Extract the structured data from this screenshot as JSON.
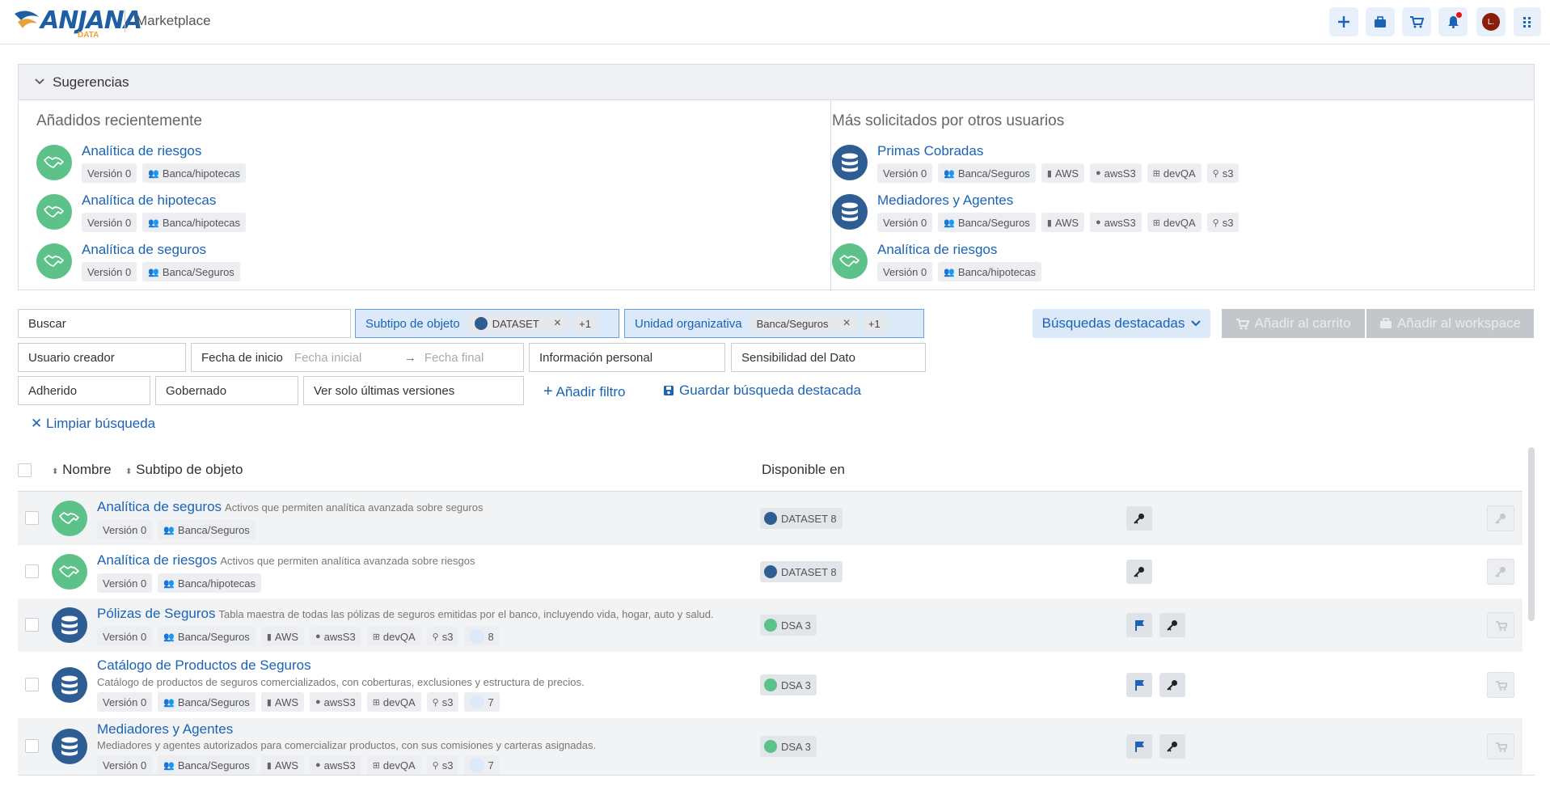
{
  "header": {
    "logo_text": "ANJANA",
    "logo_sub": "DATA",
    "title": "Marketplace",
    "avatar_initial": "L."
  },
  "suggestions": {
    "title": "Sugerencias",
    "recent": {
      "title": "Añadidos recientemente",
      "items": [
        {
          "name": "Analítica de riesgos",
          "icon": "handshake-icon",
          "tags": [
            "Versión 0",
            "Banca/hipotecas"
          ]
        },
        {
          "name": "Analítica de hipotecas",
          "icon": "handshake-icon",
          "tags": [
            "Versión 0",
            "Banca/hipotecas"
          ]
        },
        {
          "name": "Analítica de seguros",
          "icon": "handshake-icon",
          "tags": [
            "Versión 0",
            "Banca/Seguros"
          ]
        }
      ]
    },
    "popular": {
      "title": "Más solicitados por otros usuarios",
      "items": [
        {
          "name": "Primas Cobradas",
          "icon": "database-icon",
          "tags": [
            "Versión 0",
            "Banca/Seguros",
            "AWS",
            "awsS3",
            "devQA",
            "s3"
          ]
        },
        {
          "name": "Mediadores y Agentes",
          "icon": "database-icon",
          "tags": [
            "Versión 0",
            "Banca/Seguros",
            "AWS",
            "awsS3",
            "devQA",
            "s3"
          ]
        },
        {
          "name": "Analítica de riesgos",
          "icon": "handshake-icon",
          "tags": [
            "Versión 0",
            "Banca/hipotecas"
          ]
        }
      ]
    }
  },
  "filters": {
    "search_label": "Buscar",
    "subtype_label": "Subtipo de objeto",
    "subtype_chip": "DATASET",
    "subtype_more": "+1",
    "org_label": "Unidad organizativa",
    "org_chip": "Banca/Seguros",
    "org_more": "+1",
    "creator": "Usuario creador",
    "start_date": "Fecha de inicio",
    "date_from_placeholder": "Fecha inicial",
    "date_to_placeholder": "Fecha final",
    "personal_info": "Información personal",
    "sensitivity": "Sensibilidad del Dato",
    "adhered": "Adherido",
    "governed": "Gobernado",
    "latest_versions": "Ver solo últimas versiones",
    "add_filter": "Añadir filtro",
    "save_search": "Guardar búsqueda destacada",
    "clear": "Limpiar búsqueda"
  },
  "actions": {
    "featured": "Búsquedas destacadas",
    "add_cart": "Añadir al carrito",
    "add_workspace": "Añadir al workspace"
  },
  "table": {
    "col_name": "Nombre",
    "col_subtype": "Subtipo de objeto",
    "col_available": "Disponible en",
    "rows": [
      {
        "name": "Analítica de seguros",
        "desc": "Activos que permiten analítica avanzada sobre seguros",
        "icon": "handshake-icon",
        "tags": [
          "Versión 0",
          "Banca/Seguros"
        ],
        "available": "DATASET 8"
      },
      {
        "name": "Analítica de riesgos",
        "desc": "Activos que permiten analítica avanzada sobre riesgos",
        "icon": "handshake-icon",
        "tags": [
          "Versión 0",
          "Banca/hipotecas"
        ],
        "available": "DATASET 8"
      },
      {
        "name": "Pólizas de Seguros",
        "desc": "Tabla maestra de todas las pólizas de seguros emitidas por el banco, incluyendo vida, hogar, auto y salud.",
        "icon": "database-icon",
        "tags": [
          "Versión 0",
          "Banca/Seguros",
          "AWS",
          "awsS3",
          "devQA",
          "s3"
        ],
        "count": "8",
        "available": "DSA 3"
      },
      {
        "name": "Catálogo de Productos de Seguros",
        "desc": "Catálogo de productos de seguros comercializados, con coberturas, exclusiones y estructura de precios.",
        "icon": "database-icon",
        "tags": [
          "Versión 0",
          "Banca/Seguros",
          "AWS",
          "awsS3",
          "devQA",
          "s3"
        ],
        "count": "7",
        "available": "DSA 3"
      },
      {
        "name": "Mediadores y Agentes",
        "desc": "Mediadores y agentes autorizados para comercializar productos, con sus comisiones y carteras asignadas.",
        "icon": "database-icon",
        "tags": [
          "Versión 0",
          "Banca/Seguros",
          "AWS",
          "awsS3",
          "devQA",
          "s3"
        ],
        "count": "7",
        "available": "DSA 3"
      }
    ]
  }
}
